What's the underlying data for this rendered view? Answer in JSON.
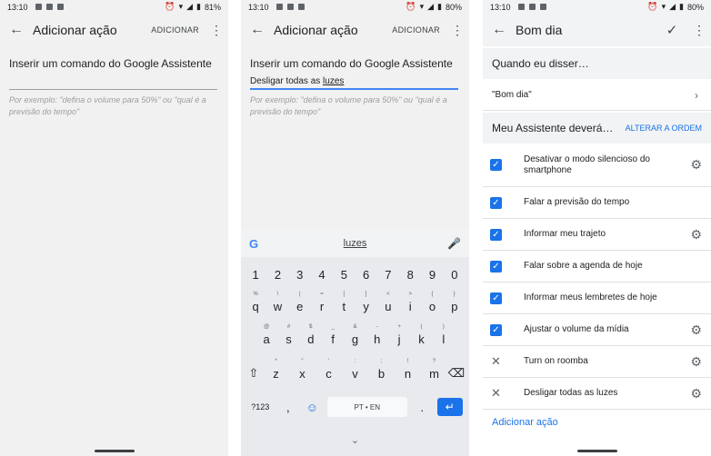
{
  "status": [
    {
      "time": "13:10",
      "battery": "81%"
    },
    {
      "time": "13:10",
      "battery": "80%"
    },
    {
      "time": "13:10",
      "battery": "80%"
    }
  ],
  "panel1": {
    "title": "Adicionar ação",
    "action": "ADICIONAR",
    "heading": "Inserir um comando do Google Assistente",
    "input_value": "",
    "hint": "Por exemplo: \"defina o volume para 50%\" ou \"qual é a previsão do tempo\""
  },
  "panel2": {
    "title": "Adicionar ação",
    "action": "ADICIONAR",
    "heading": "Inserir um comando do Google Assistente",
    "input_prefix": "Desligar todas as ",
    "input_word": "luzes",
    "hint": "Por exemplo: \"defina o volume para 50%\" ou \"qual é a previsão do tempo\"",
    "keyboard": {
      "suggestion": "luzes",
      "numbers": [
        "1",
        "2",
        "3",
        "4",
        "5",
        "6",
        "7",
        "8",
        "9",
        "0"
      ],
      "row1": [
        {
          "k": "q",
          "s": "%"
        },
        {
          "k": "w",
          "s": "\\"
        },
        {
          "k": "e",
          "s": "|"
        },
        {
          "k": "r",
          "s": "="
        },
        {
          "k": "t",
          "s": "["
        },
        {
          "k": "y",
          "s": "]"
        },
        {
          "k": "u",
          "s": "<"
        },
        {
          "k": "i",
          "s": ">"
        },
        {
          "k": "o",
          "s": "{"
        },
        {
          "k": "p",
          "s": "}"
        }
      ],
      "row2": [
        {
          "k": "a",
          "s": "@"
        },
        {
          "k": "s",
          "s": "#"
        },
        {
          "k": "d",
          "s": "$"
        },
        {
          "k": "f",
          "s": "_"
        },
        {
          "k": "g",
          "s": "&"
        },
        {
          "k": "h",
          "s": "-"
        },
        {
          "k": "j",
          "s": "+"
        },
        {
          "k": "k",
          "s": "("
        },
        {
          "k": "l",
          "s": ")"
        }
      ],
      "row3": [
        {
          "k": "z",
          "s": "*"
        },
        {
          "k": "x",
          "s": "\""
        },
        {
          "k": "c",
          "s": "'"
        },
        {
          "k": "v",
          "s": ":"
        },
        {
          "k": "b",
          "s": ";"
        },
        {
          "k": "n",
          "s": "!"
        },
        {
          "k": "m",
          "s": "?"
        }
      ],
      "sym_label": "?123",
      "comma": ",",
      "space_label": "PT • EN",
      "period": "."
    }
  },
  "panel3": {
    "title": "Bom dia",
    "when_heading": "Quando eu disser…",
    "phrase": "\"Bom dia\"",
    "assistant_heading": "Meu Assistente deverá…",
    "reorder": "ALTERAR A ORDEM",
    "actions": [
      {
        "label": "Desativar o modo silencioso do smartphone",
        "checked": true,
        "gear": true
      },
      {
        "label": "Falar a previsão do tempo",
        "checked": true,
        "gear": false
      },
      {
        "label": "Informar meu trajeto",
        "checked": true,
        "gear": true
      },
      {
        "label": "Falar sobre a agenda de hoje",
        "checked": true,
        "gear": false
      },
      {
        "label": "Informar meus lembretes de hoje",
        "checked": true,
        "gear": false
      },
      {
        "label": "Ajustar o volume da mídia",
        "checked": true,
        "gear": true
      },
      {
        "label": "Turn on roomba",
        "checked": false,
        "gear": true
      },
      {
        "label": "Desligar todas as luzes",
        "checked": false,
        "gear": true
      }
    ],
    "add_action": "Adicionar ação"
  },
  "colors": {
    "accent": "#1a73e8",
    "background": "#f1f1f1"
  }
}
